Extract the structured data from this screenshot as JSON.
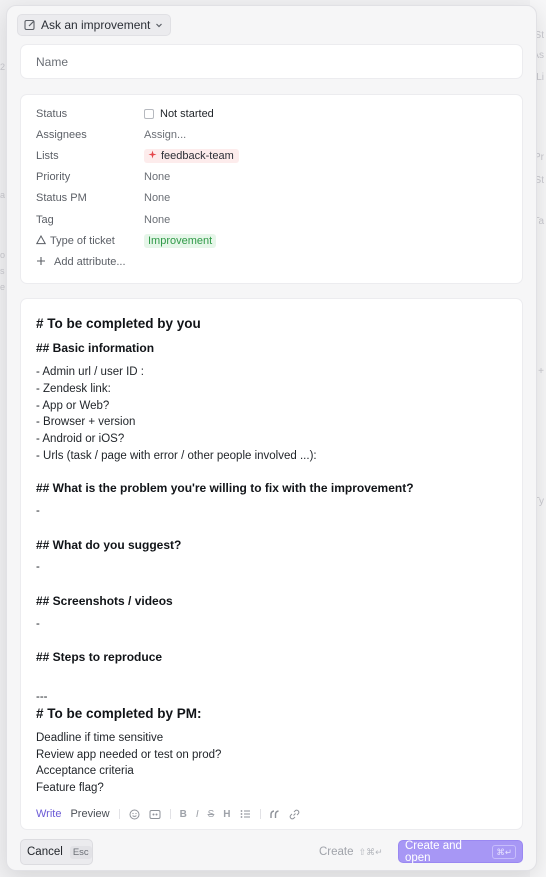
{
  "backdrop": {
    "right_glyphs": [
      "St",
      "As",
      "Li",
      "Pr",
      "St",
      "Ta",
      "Ty",
      "+"
    ],
    "left_glyphs": [
      "2",
      "a",
      "o",
      "s",
      "e"
    ]
  },
  "template": {
    "label": "Ask an improvement",
    "icon": "edit-square-icon",
    "chevron": "chevron-down-icon"
  },
  "name_field": {
    "placeholder": "Name",
    "value": ""
  },
  "attributes": {
    "status": {
      "label": "Status",
      "value": "Not started"
    },
    "assignees": {
      "label": "Assignees",
      "value": "Assign..."
    },
    "lists": {
      "label": "Lists",
      "value": "feedback-team",
      "color": "#fdecec"
    },
    "priority": {
      "label": "Priority",
      "value": "None"
    },
    "status_pm": {
      "label": "Status PM",
      "value": "None"
    },
    "tag": {
      "label": "Tag",
      "value": "None"
    },
    "type_of_ticket": {
      "label": "Type of ticket",
      "value": "Improvement",
      "color": "#2f9a47"
    },
    "add_attribute": {
      "label": "Add attribute..."
    }
  },
  "editor": {
    "h1_you": "# To be completed by you",
    "h2_basic": "## Basic information",
    "basic_lines": [
      "- Admin url / user ID :",
      "- Zendesk link:",
      "- App or Web?",
      "- Browser + version",
      "- Android or iOS?",
      "- Urls (task / page with error / other people involved ...):"
    ],
    "h2_problem": "## What is the problem you're willing to fix with the improvement?",
    "dash1": "-",
    "h2_suggest": "## What do you suggest?",
    "dash2": "-",
    "h2_screens": "## Screenshots / videos",
    "dash3": "-",
    "h2_steps": "## Steps to reproduce",
    "hr": "---",
    "h1_pm": "# To be completed by PM:",
    "pm_lines": [
      "Deadline if time sensitive",
      "Review app needed or test on prod?",
      "Acceptance criteria",
      "Feature flag?"
    ]
  },
  "toolbar": {
    "write": "Write",
    "preview": "Preview",
    "bold": "B",
    "italic": "I",
    "strike": "S",
    "heading": "H"
  },
  "footer": {
    "cancel": "Cancel",
    "cancel_kbd": "Esc",
    "create": "Create",
    "create_kbd": "⇧⌘↵",
    "create_open": "Create and open",
    "create_open_kbd": "⌘↵",
    "accent": "#a797f5"
  }
}
